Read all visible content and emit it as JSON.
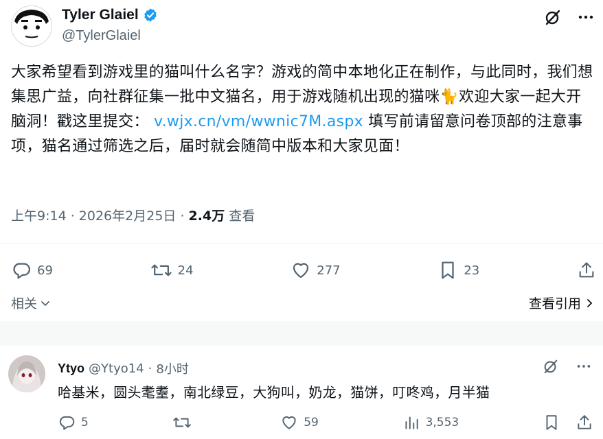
{
  "author": {
    "name": "Tyler Glaiel",
    "handle": "@TylerGlaiel"
  },
  "tweet": {
    "text_part1": "大家希望看到游戏里的猫叫什么名字？游戏的简中本地化正在制作，与此同时，我们想集思广益，向社群征集一批中文猫名，用于游戏随机出现的猫咪",
    "emoji": "🐈",
    "text_part2": "欢迎大家一起大开脑洞！戳这里提交：",
    "link": "v.wjx.cn/vm/wwnic7M.aspx",
    "text_part3": "填写前请留意问卷顶部的注意事项，猫名通过筛选之后，届时就会随简中版本和大家见面！",
    "time": "上午9:14",
    "date": "2026年2月25日",
    "views": "2.4万",
    "views_label": "查看"
  },
  "actions": {
    "replies": "69",
    "retweets": "24",
    "likes": "277",
    "bookmarks": "23"
  },
  "footer": {
    "related": "相关",
    "view_quotes": "查看引用"
  },
  "reply": {
    "name": "Ytyo",
    "handle": "@Ytyo14",
    "time": "8小时",
    "text": "哈基米，圆头耄耋，南北绿豆，大狗叫，奶龙，猫饼，叮咚鸡，月半猫",
    "replies": "5",
    "retweets": "",
    "likes": "59",
    "views": "3,553"
  },
  "colors": {
    "accent": "#1d9bf0",
    "muted": "#536471",
    "text": "#0f1419"
  }
}
